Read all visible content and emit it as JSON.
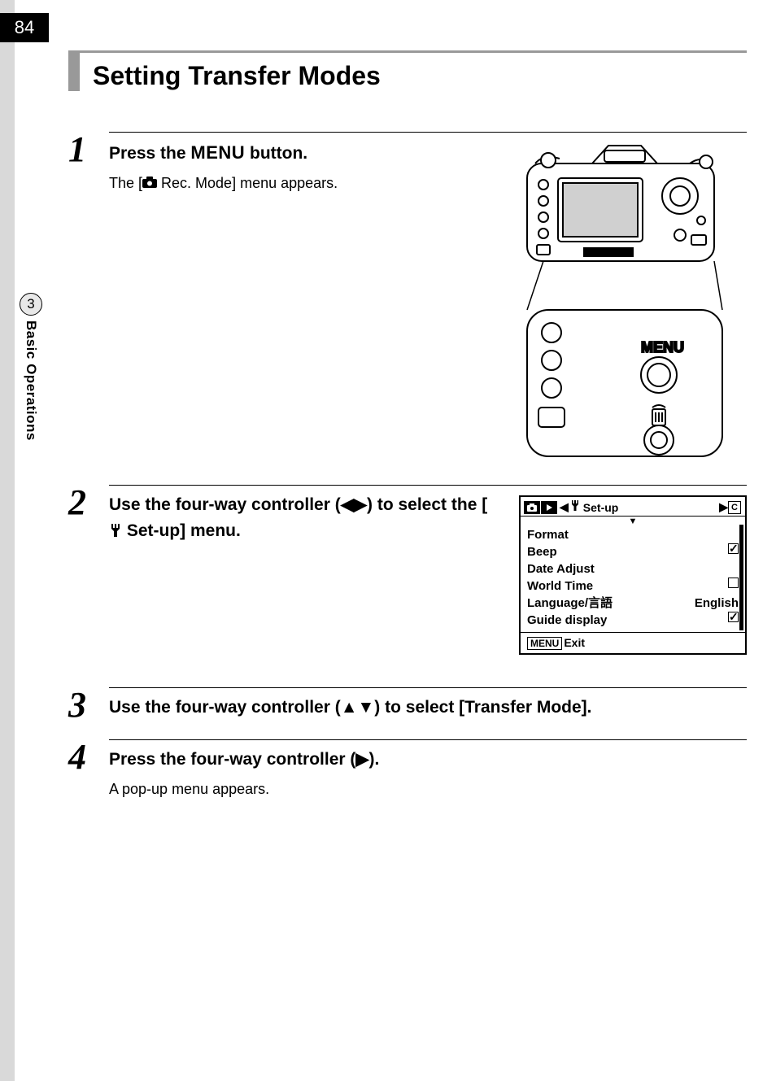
{
  "page_number": "84",
  "chapter": {
    "number": "3",
    "title": "Basic Operations"
  },
  "section_title": "Setting Transfer Modes",
  "steps": {
    "s1": {
      "num": "1",
      "heading_pre": "Press the ",
      "heading_menu": "MENU",
      "heading_post": " button.",
      "desc_pre": "The [",
      "desc_post": " Rec. Mode] menu appears."
    },
    "s2": {
      "num": "2",
      "heading": "Use the four-way controller (◀▶) to select the [",
      "heading_tool_suffix": " Set-up] menu."
    },
    "s3": {
      "num": "3",
      "heading": "Use the four-way controller (▲▼) to select [Transfer Mode]."
    },
    "s4": {
      "num": "4",
      "heading": "Press the four-way controller (▶).",
      "desc": "A pop-up menu appears."
    }
  },
  "camera_diagram": {
    "menu_label": "MENU"
  },
  "lcd": {
    "tab_title": "Set-up",
    "arrow_left": "◀",
    "arrow_right": "▶",
    "tab_right": "C",
    "items": {
      "format": "Format",
      "beep": "Beep",
      "date_adjust": "Date Adjust",
      "world_time": "World Time",
      "language": "Language/言語",
      "language_val": "English",
      "guide_display": "Guide display"
    },
    "footer_badge": "MENU",
    "footer_text": "Exit",
    "down_marker": "▼"
  }
}
